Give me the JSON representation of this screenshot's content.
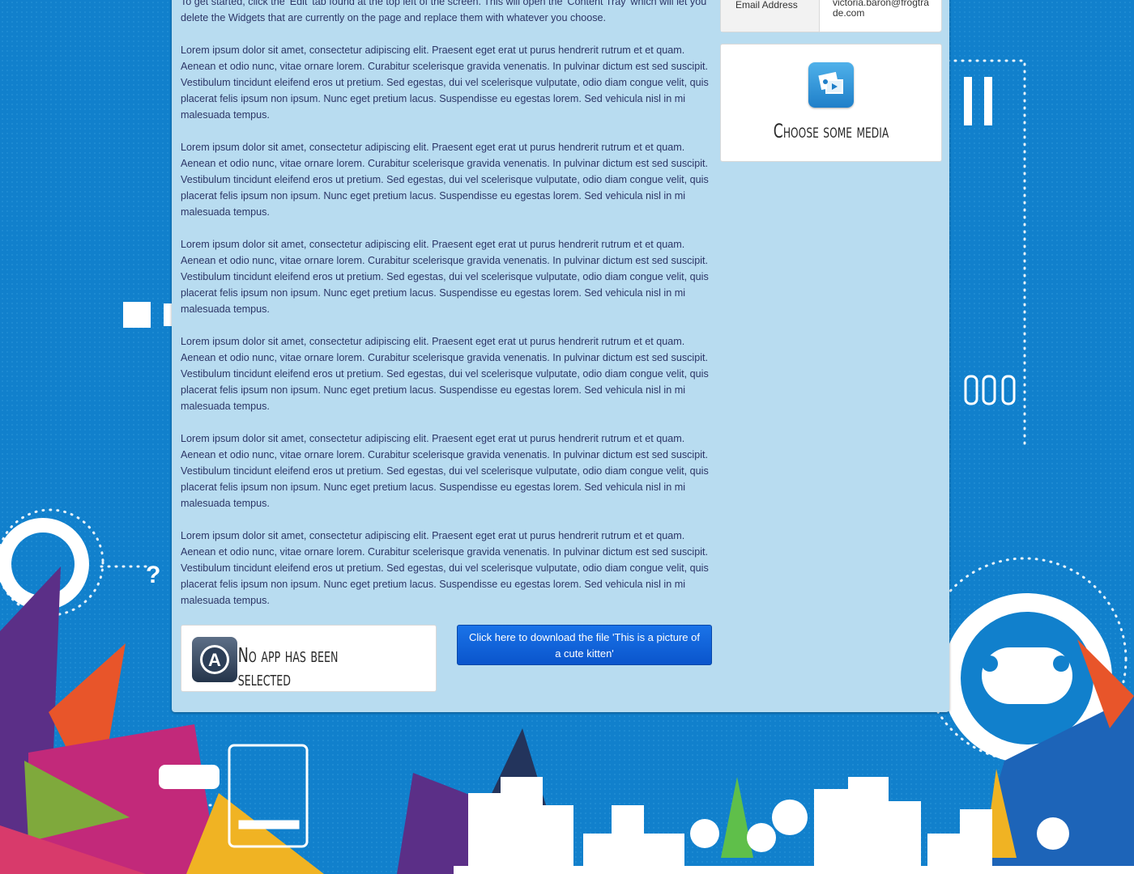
{
  "intro_text": "To get started, click the 'Edit' tab found at the top left of the screen. This will open the 'Content Tray' which will let you delete the Widgets that are currently on the page and replace them with whatever you choose.",
  "paragraphs": [
    "Lorem ipsum dolor sit amet, consectetur adipiscing elit. Praesent eget erat ut purus hendrerit rutrum et et quam. Aenean et odio nunc, vitae ornare lorem. Curabitur scelerisque gravida venenatis. In pulvinar dictum est sed suscipit. Vestibulum tincidunt eleifend eros ut pretium. Sed egestas, dui vel scelerisque vulputate, odio diam congue velit, quis placerat felis ipsum non ipsum. Nunc eget pretium lacus. Suspendisse eu egestas lorem. Sed vehicula nisl in mi malesuada tempus.",
    "Lorem ipsum dolor sit amet, consectetur adipiscing elit. Praesent eget erat ut purus hendrerit rutrum et et quam. Aenean et odio nunc, vitae ornare lorem. Curabitur scelerisque gravida venenatis. In pulvinar dictum est sed suscipit. Vestibulum tincidunt eleifend eros ut pretium. Sed egestas, dui vel scelerisque vulputate, odio diam congue velit, quis placerat felis ipsum non ipsum. Nunc eget pretium lacus. Suspendisse eu egestas lorem. Sed vehicula nisl in mi malesuada tempus.",
    "Lorem ipsum dolor sit amet, consectetur adipiscing elit. Praesent eget erat ut purus hendrerit rutrum et et quam. Aenean et odio nunc, vitae ornare lorem. Curabitur scelerisque gravida venenatis. In pulvinar dictum est sed suscipit. Vestibulum tincidunt eleifend eros ut pretium. Sed egestas, dui vel scelerisque vulputate, odio diam congue velit, quis placerat felis ipsum non ipsum. Nunc eget pretium lacus. Suspendisse eu egestas lorem. Sed vehicula nisl in mi malesuada tempus.",
    "Lorem ipsum dolor sit amet, consectetur adipiscing elit. Praesent eget erat ut purus hendrerit rutrum et et quam. Aenean et odio nunc, vitae ornare lorem. Curabitur scelerisque gravida venenatis. In pulvinar dictum est sed suscipit. Vestibulum tincidunt eleifend eros ut pretium. Sed egestas, dui vel scelerisque vulputate, odio diam congue velit, quis placerat felis ipsum non ipsum. Nunc eget pretium lacus. Suspendisse eu egestas lorem. Sed vehicula nisl in mi malesuada tempus.",
    "Lorem ipsum dolor sit amet, consectetur adipiscing elit. Praesent eget erat ut purus hendrerit rutrum et et quam. Aenean et odio nunc, vitae ornare lorem. Curabitur scelerisque gravida venenatis. In pulvinar dictum est sed suscipit. Vestibulum tincidunt eleifend eros ut pretium. Sed egestas, dui vel scelerisque vulputate, odio diam congue velit, quis placerat felis ipsum non ipsum. Nunc eget pretium lacus. Suspendisse eu egestas lorem. Sed vehicula nisl in mi malesuada tempus.",
    "Lorem ipsum dolor sit amet, consectetur adipiscing elit. Praesent eget erat ut purus hendrerit rutrum et et quam. Aenean et odio nunc, vitae ornare lorem. Curabitur scelerisque gravida venenatis. In pulvinar dictum est sed suscipit. Vestibulum tincidunt eleifend eros ut pretium. Sed egestas, dui vel scelerisque vulputate, odio diam congue velit, quis placerat felis ipsum non ipsum. Nunc eget pretium lacus. Suspendisse eu egestas lorem. Sed vehicula nisl in mi malesuada tempus."
  ],
  "profile": {
    "email_label": "Email Address",
    "email_value": "victoria.baron@frogtrade.com"
  },
  "media_widget": {
    "title": "Choose some media",
    "icon": "media-gallery-icon"
  },
  "app_widget": {
    "title": "No app has been selected",
    "icon": "app-store-icon"
  },
  "download_button": {
    "label": "Click here to download the file 'This is a picture of a cute kitten'"
  },
  "colors": {
    "background": "#1487d0",
    "panel": "#b8dcf0",
    "text": "#2c3566",
    "button": "#0a5fd6"
  }
}
